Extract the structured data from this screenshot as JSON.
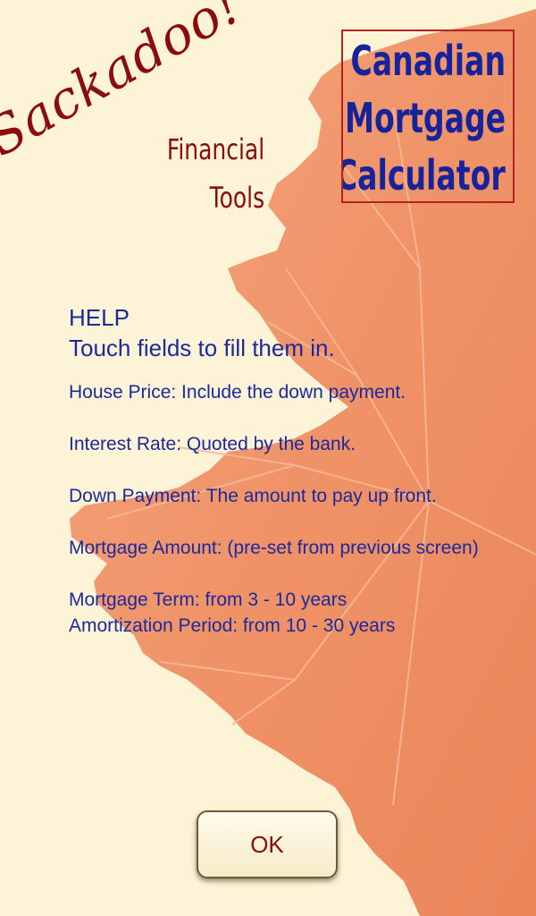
{
  "branding": {
    "name": "Sackadoo!",
    "subtitle_line1": "Financial",
    "subtitle_line2": "Tools"
  },
  "title": {
    "line1": "Canadian",
    "line2": "Mortgage",
    "line3": "Calculator"
  },
  "help": {
    "heading": "HELP",
    "subheading": "Touch fields to fill them in.",
    "house_price": "House Price: Include the down payment.",
    "interest_rate": "Interest Rate: Quoted by the bank.",
    "down_payment": "Down Payment: The amount to pay up front.",
    "mortgage_amount": "Mortgage Amount: (pre-set from previous screen)",
    "mortgage_term": "Mortgage Term: from 3 - 10 years",
    "amortization": "Amortization Period: from 10 - 30 years"
  },
  "buttons": {
    "ok_label": "OK"
  },
  "colors": {
    "background": "#fdf3d6",
    "brand_red": "#8a0c0c",
    "title_blue": "#16239a",
    "help_blue": "#1a2a9e",
    "leaf_orange": "#f08a5c"
  },
  "icons": {
    "background_art": "maple-leaf-icon"
  }
}
